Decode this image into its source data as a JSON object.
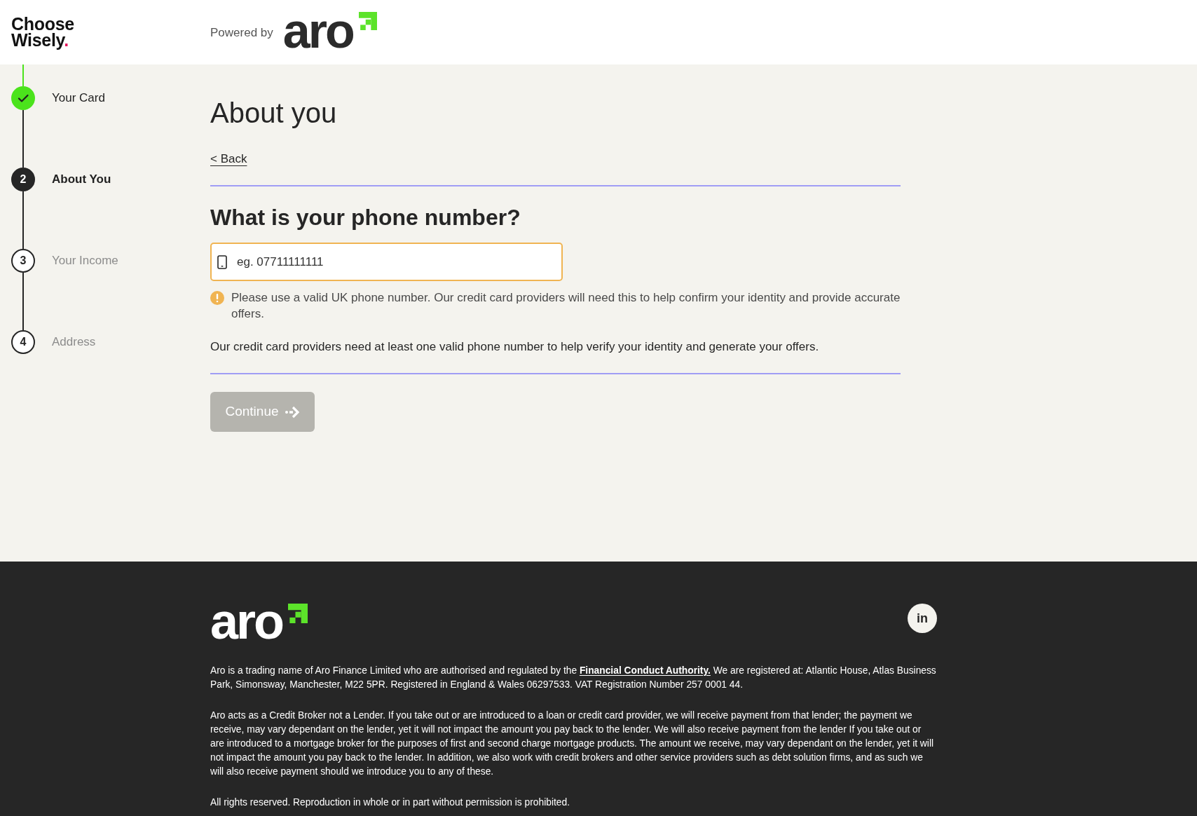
{
  "header": {
    "brand": {
      "lines": [
        "Choose",
        "Wisely"
      ],
      "accent": "."
    },
    "powered_by": "Powered by",
    "partner_logo": "aro"
  },
  "stepper": {
    "steps": [
      {
        "label": "Your Card",
        "completed": true,
        "selected": false
      },
      {
        "number": "2",
        "label": "About You",
        "completed": false,
        "selected": true
      },
      {
        "number": "3",
        "label": "Your Income",
        "completed": false,
        "selected": false
      },
      {
        "number": "4",
        "label": "Address",
        "completed": false,
        "selected": false
      }
    ]
  },
  "form": {
    "title": "About you",
    "back_link": "< Back",
    "question": "What is your phone number?",
    "phone_field": {
      "placeholder": "eg. 07711111111"
    },
    "warning": "Please use a valid UK phone number. Our credit card providers will need this to help confirm your identity and provide accurate offers.",
    "note": "Our credit card providers need at least one valid phone number to help verify your identity and generate your offers.",
    "continue_button": {
      "label": "Continue",
      "disabled": true
    }
  },
  "footer": {
    "logo": "aro",
    "social_links": [
      {
        "label": "in"
      }
    ],
    "legal": [
      {
        "text": "Aro is a trading name of Aro Finance Limited who are authorised and regulated by the",
        "link": "Financial Conduct Authority.",
        "text_after": "We are registered at: Atlantic House, Atlas Business Park, Simonsway, Manchester, M22 5PR. Registered in England & Wales 06297533. VAT Registration Number 257 0001 44."
      },
      {
        "text": "Aro acts as a Credit Broker not a Lender. If you take out or are introduced to a loan or credit card provider, we will receive payment from that lender; the payment we receive, may vary dependant on the lender, yet it will not impact the amount you pay back to the lender. We will also receive payment from the lender If you take out or are introduced to a mortgage broker for the purposes of first and second charge mortgage products. The amount we receive, may vary dependant on the lender, yet it will not impact the amount you pay back to the lender. In addition, we also work with credit brokers and other service providers such as debt solution firms, and as such we will also receive payment should we introduce you to any of these."
      },
      {
        "text": "All rights reserved. Reproduction in whole or in part without permission is prohibited."
      }
    ]
  }
}
